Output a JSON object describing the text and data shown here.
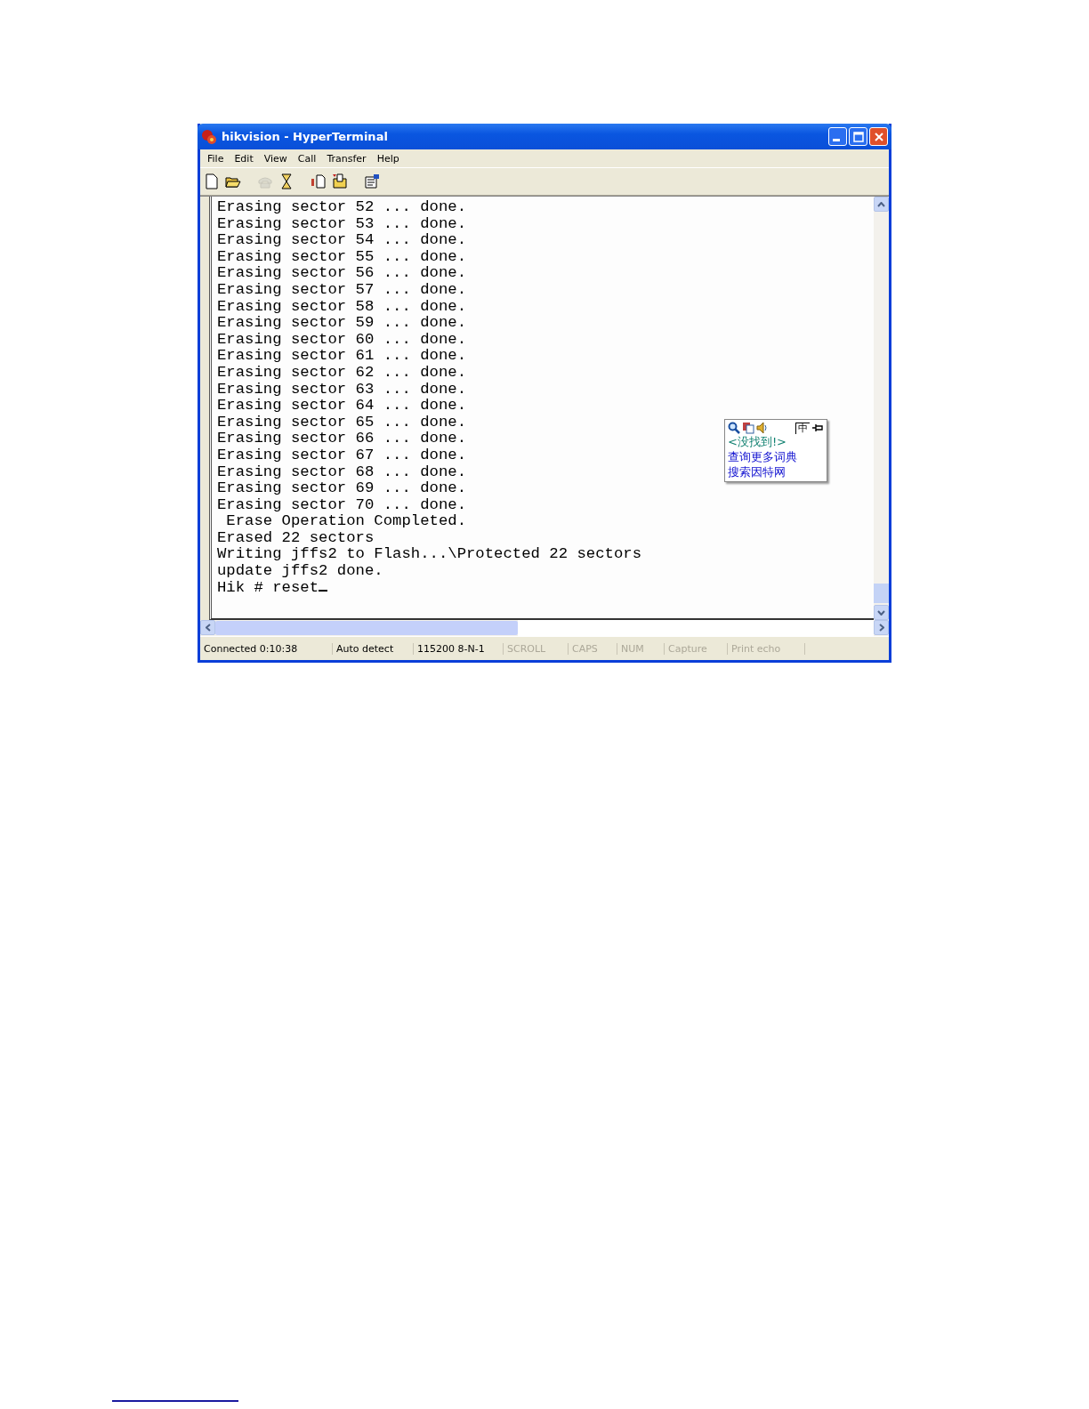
{
  "window": {
    "title": "hikvision - HyperTerminal"
  },
  "menu": [
    "File",
    "Edit",
    "View",
    "Call",
    "Transfer",
    "Help"
  ],
  "toolbar": [
    {
      "kind": "new",
      "disabled": false
    },
    {
      "kind": "open",
      "disabled": false
    },
    {
      "kind": "call",
      "disabled": true
    },
    {
      "kind": "disconnect",
      "disabled": false
    },
    {
      "kind": "send",
      "disabled": false
    },
    {
      "kind": "receive",
      "disabled": false
    },
    {
      "kind": "properties",
      "disabled": false
    }
  ],
  "terminal": {
    "lines": [
      "Erasing sector 52 ... done.",
      "Erasing sector 53 ... done.",
      "Erasing sector 54 ... done.",
      "Erasing sector 55 ... done.",
      "Erasing sector 56 ... done.",
      "Erasing sector 57 ... done.",
      "Erasing sector 58 ... done.",
      "Erasing sector 59 ... done.",
      "Erasing sector 60 ... done.",
      "Erasing sector 61 ... done.",
      "Erasing sector 62 ... done.",
      "Erasing sector 63 ... done.",
      "Erasing sector 64 ... done.",
      "Erasing sector 65 ... done.",
      "Erasing sector 66 ... done.",
      "Erasing sector 67 ... done.",
      "Erasing sector 68 ... done.",
      "Erasing sector 69 ... done.",
      "Erasing sector 70 ... done.",
      " Erase Operation Completed.",
      "Erased 22 sectors",
      "Writing jffs2 to Flash...\\Protected 22 sectors",
      "update jffs2 done.",
      "Hik # reset"
    ]
  },
  "dictionary_popup": {
    "mode": "中",
    "result": "<没找到!>",
    "links": [
      "查询更多词典",
      "搜索因特网"
    ]
  },
  "status_bar": [
    {
      "text": "Connected 0:10:38",
      "disabled": false
    },
    {
      "text": "Auto detect",
      "disabled": false
    },
    {
      "text": "115200 8-N-1",
      "disabled": false
    },
    {
      "text": "SCROLL",
      "disabled": true
    },
    {
      "text": "CAPS",
      "disabled": true
    },
    {
      "text": "NUM",
      "disabled": true
    },
    {
      "text": "Capture",
      "disabled": true
    },
    {
      "text": "Print echo",
      "disabled": true
    }
  ]
}
